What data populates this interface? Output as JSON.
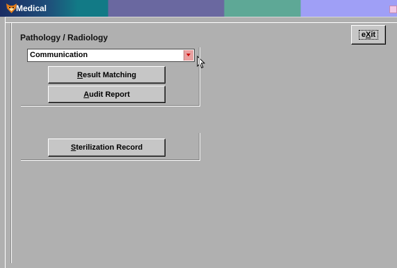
{
  "window": {
    "title": "Medical"
  },
  "icons": {
    "app": "app-fox-icon",
    "close": "close-icon",
    "dropdown": "chevron-down-icon",
    "cursor": "mouse-pointer-icon"
  },
  "colors": {
    "client_bg": "#b0b0b0",
    "button_face": "#c6c6c6",
    "combo_button": "#e8a0a0",
    "combo_arrow": "#cc0000"
  },
  "pathology": {
    "heading": "Pathology / Radiology",
    "selected_value": "Communication",
    "result_matching": {
      "accel": "R",
      "rest": "esult Matching"
    },
    "audit_report": {
      "accel": "A",
      "rest": "udit Report"
    }
  },
  "sterilization": {
    "button": {
      "accel": "S",
      "rest": "terilization Record"
    }
  },
  "toolbar": {
    "exit": {
      "before": "e",
      "accel": "X",
      "after": "it"
    }
  }
}
